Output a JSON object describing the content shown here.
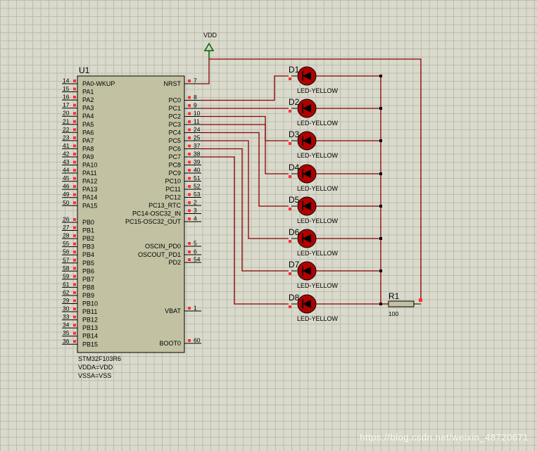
{
  "chip": {
    "ref": "U1",
    "part": "STM32F103R6",
    "notes": [
      "VDDA=VDD",
      "VSSA=VSS"
    ],
    "left_pins": [
      {
        "num": "14",
        "name": "PA0-WKUP"
      },
      {
        "num": "15",
        "name": "PA1"
      },
      {
        "num": "16",
        "name": "PA2"
      },
      {
        "num": "17",
        "name": "PA3"
      },
      {
        "num": "20",
        "name": "PA4"
      },
      {
        "num": "21",
        "name": "PA5"
      },
      {
        "num": "22",
        "name": "PA6"
      },
      {
        "num": "23",
        "name": "PA7"
      },
      {
        "num": "41",
        "name": "PA8"
      },
      {
        "num": "42",
        "name": "PA9"
      },
      {
        "num": "43",
        "name": "PA10"
      },
      {
        "num": "44",
        "name": "PA11"
      },
      {
        "num": "45",
        "name": "PA12"
      },
      {
        "num": "46",
        "name": "PA13"
      },
      {
        "num": "49",
        "name": "PA14"
      },
      {
        "num": "50",
        "name": "PA15"
      },
      {
        "num": "26",
        "name": "PB0"
      },
      {
        "num": "27",
        "name": "PB1"
      },
      {
        "num": "28",
        "name": "PB2"
      },
      {
        "num": "55",
        "name": "PB3"
      },
      {
        "num": "56",
        "name": "PB4"
      },
      {
        "num": "57",
        "name": "PB5"
      },
      {
        "num": "58",
        "name": "PB6"
      },
      {
        "num": "59",
        "name": "PB7"
      },
      {
        "num": "61",
        "name": "PB8"
      },
      {
        "num": "62",
        "name": "PB9"
      },
      {
        "num": "29",
        "name": "PB10"
      },
      {
        "num": "30",
        "name": "PB11"
      },
      {
        "num": "33",
        "name": "PB12"
      },
      {
        "num": "34",
        "name": "PB13"
      },
      {
        "num": "35",
        "name": "PB14"
      },
      {
        "num": "36",
        "name": "PB15"
      }
    ],
    "right_pins": [
      {
        "num": "7",
        "name": "NRST"
      },
      {
        "num": "8",
        "name": "PC0"
      },
      {
        "num": "9",
        "name": "PC1"
      },
      {
        "num": "10",
        "name": "PC2"
      },
      {
        "num": "11",
        "name": "PC3"
      },
      {
        "num": "24",
        "name": "PC4"
      },
      {
        "num": "25",
        "name": "PC5"
      },
      {
        "num": "37",
        "name": "PC6"
      },
      {
        "num": "38",
        "name": "PC7"
      },
      {
        "num": "39",
        "name": "PC8"
      },
      {
        "num": "40",
        "name": "PC9"
      },
      {
        "num": "51",
        "name": "PC10"
      },
      {
        "num": "52",
        "name": "PC11"
      },
      {
        "num": "53",
        "name": "PC12"
      },
      {
        "num": "2",
        "name": "PC13_RTC"
      },
      {
        "num": "3",
        "name": "PC14-OSC32_IN"
      },
      {
        "num": "4",
        "name": "PC15-OSC32_OUT"
      },
      {
        "num": "5",
        "name": "OSCIN_PD0"
      },
      {
        "num": "6",
        "name": "OSCOUT_PD1"
      },
      {
        "num": "54",
        "name": "PD2"
      },
      {
        "num": "1",
        "name": "VBAT"
      },
      {
        "num": "60",
        "name": "BOOT0"
      }
    ]
  },
  "power": {
    "label": "VDD"
  },
  "leds": [
    {
      "ref": "D1",
      "value": "LED-YELLOW"
    },
    {
      "ref": "D2",
      "value": "LED-YELLOW"
    },
    {
      "ref": "D3",
      "value": "LED-YELLOW"
    },
    {
      "ref": "D4",
      "value": "LED-YELLOW"
    },
    {
      "ref": "D5",
      "value": "LED-YELLOW"
    },
    {
      "ref": "D6",
      "value": "LED-YELLOW"
    },
    {
      "ref": "D7",
      "value": "LED-YELLOW"
    },
    {
      "ref": "D8",
      "value": "LED-YELLOW"
    }
  ],
  "resistor": {
    "ref": "R1",
    "value": "100"
  },
  "watermark": "https://blog.csdn.net/weixin_48720671",
  "colors": {
    "wire": "#8b0000",
    "led_body": "#b00000",
    "chip_fill": "#c2c2a3",
    "pin_dot": "#ff3030"
  }
}
